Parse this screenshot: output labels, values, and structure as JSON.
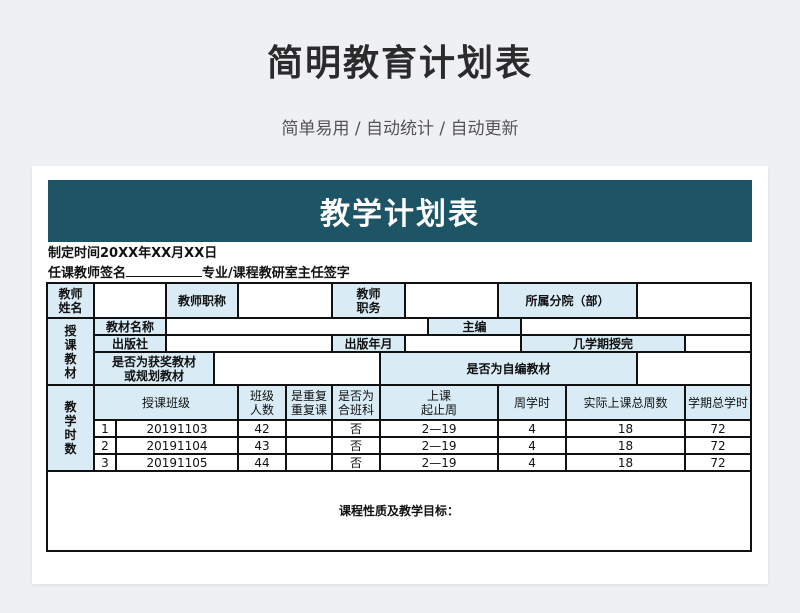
{
  "page": {
    "title": "简明教育计划表",
    "subtitle": "简单易用 / 自动统计 / 自动更新"
  },
  "sheet": {
    "banner": "教学计划表",
    "made_time": "制定时间20XX年XX月XX日",
    "sign_teacher": "任课教师签名",
    "sign_director": "专业/课程教研室主任签字"
  },
  "table": {
    "teacher_name": "教师\n姓名",
    "teacher_rank": "教师职称",
    "teacher_post": "教师\n职务",
    "department": "所属分院（部）",
    "textbook_section": "授\n课\n教\n材",
    "textbook_name": "教材名称",
    "chief_editor": "主编",
    "publisher": "出版社",
    "pub_year": "出版年月",
    "semesters": "几学期授完",
    "award": "是否为获奖教材\n或规划教材",
    "self_edited": "是否为自编教材",
    "teaching_section": "教\n学\n时\n数",
    "headers": {
      "class": "授课班级",
      "count": "班级\n人数",
      "repeat": "是重复\n重复课",
      "combined": "是否为\n合班科",
      "period": "上课\n起止周",
      "weekly": "周学时",
      "total_weeks": "实际上课总周数",
      "total_hours": "学期总学时"
    },
    "rows": [
      {
        "no": "1",
        "class": "20191103",
        "count": "42",
        "repeat": "",
        "combined": "否",
        "period": "2—19",
        "weekly": "4",
        "total_weeks": "18",
        "total_hours": "72"
      },
      {
        "no": "2",
        "class": "20191104",
        "count": "43",
        "repeat": "",
        "combined": "否",
        "period": "2—19",
        "weekly": "4",
        "total_weeks": "18",
        "total_hours": "72"
      },
      {
        "no": "3",
        "class": "20191105",
        "count": "44",
        "repeat": "",
        "combined": "否",
        "period": "2—19",
        "weekly": "4",
        "total_weeks": "18",
        "total_hours": "72"
      }
    ],
    "goal_label": "课程性质及教学目标："
  },
  "colors": {
    "banner": "#1e5566",
    "header_fill": "#d9ecf5",
    "background": "#eef0f3"
  }
}
